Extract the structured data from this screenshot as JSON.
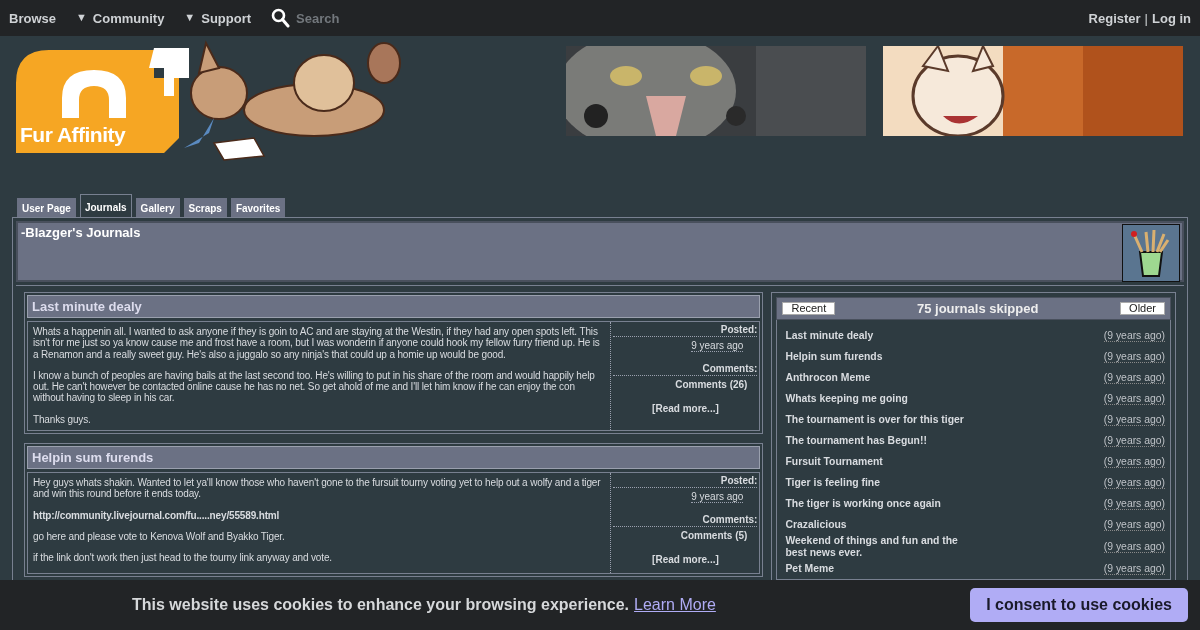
{
  "top_nav": {
    "items": [
      {
        "label": "Browse",
        "caret": false
      },
      {
        "label": "Community",
        "caret": true
      },
      {
        "label": "Support",
        "caret": true
      }
    ],
    "caret_glyph": "▼",
    "search": {
      "placeholder": "Search"
    },
    "account_links": [
      "Register",
      "Log in"
    ],
    "separator": "|"
  },
  "logo": {
    "text": "Fur Affinity"
  },
  "tabs": [
    {
      "label": "User Page",
      "selected": false
    },
    {
      "label": "Journals",
      "selected": true
    },
    {
      "label": "Gallery",
      "selected": false
    },
    {
      "label": "Scraps",
      "selected": false
    },
    {
      "label": "Favorites",
      "selected": false
    }
  ],
  "page_title": "-Blazger's Journals",
  "journals": [
    {
      "title": "Last minute dealy",
      "paragraphs": [
        {
          "kind": "text",
          "text": "Whats a happenin all. I wanted to ask anyone if they is goin to AC and are staying at the Westin, if they had any open spots left. This isn't for me just so ya know cause me and frost have a room, but I was wonderin if anyone could hook my fellow furry friend up. He is a Renamon and a really sweet guy. He's also a juggalo so any ninja's that could up a homie up would be good."
        },
        {
          "kind": "text",
          "text": "I know a bunch of peoples are having bails at the last second too. He's willing to put in his share of the room and would happily help out. He can't however be contacted online cause he has no net. So get ahold of me and I'll let him know if he can enjoy the con without having to sleep in his car."
        },
        {
          "kind": "text",
          "text": "Thanks guys."
        }
      ],
      "posted_label": "Posted:",
      "posted": "9 years ago",
      "comments_label": "Comments:",
      "comments": "Comments (26)",
      "read_more": "[Read more...]"
    },
    {
      "title": "Helpin sum furends",
      "paragraphs": [
        {
          "kind": "text",
          "text": "Hey guys whats shakin. Wanted to let ya'll know those who haven't gone to the fursuit tourny voting yet to help out a wolfy and a tiger and win this round before it ends today."
        },
        {
          "kind": "link",
          "text": "http://community.livejournal.com/fu.....ney/55589.html"
        },
        {
          "kind": "text",
          "text": "go here and please vote to Kenova Wolf and Byakko Tiger."
        },
        {
          "kind": "text",
          "text": "if the link don't work then just head to the tourny link anyway and vote."
        }
      ],
      "posted_label": "Posted:",
      "posted": "9 years ago",
      "comments_label": "Comments:",
      "comments": "Comments (5)",
      "read_more": "[Read more...]"
    }
  ],
  "sidebar": {
    "recent": "Recent",
    "title": "75 journals skipped",
    "older": "Older",
    "items": [
      {
        "title": "Last minute dealy",
        "time": "(9 years ago)"
      },
      {
        "title": "Helpin sum furends",
        "time": "(9 years ago)"
      },
      {
        "title": "Anthrocon Meme",
        "time": "(9 years ago)"
      },
      {
        "title": "Whats keeping me going",
        "time": "(9 years ago)"
      },
      {
        "title": "The tournament is over for this tiger",
        "time": "(9 years ago)"
      },
      {
        "title": "The tournament has Begun!!",
        "time": "(9 years ago)"
      },
      {
        "title": "Fursuit Tournament",
        "time": "(9 years ago)"
      },
      {
        "title": "Tiger is feeling fine",
        "time": "(9 years ago)"
      },
      {
        "title": "The tiger is working once again",
        "time": "(9 years ago)"
      },
      {
        "title": "Crazalicious",
        "time": "(9 years ago)"
      },
      {
        "title": "Weekend of things and fun and the best news ever.",
        "time": "(9 years ago)"
      },
      {
        "title": "Pet Meme",
        "time": "(9 years ago)"
      }
    ]
  },
  "cookie_bar": {
    "message": "This website uses cookies to enhance your browsing experience.",
    "link": "Learn More",
    "button": "I consent to use cookies"
  }
}
